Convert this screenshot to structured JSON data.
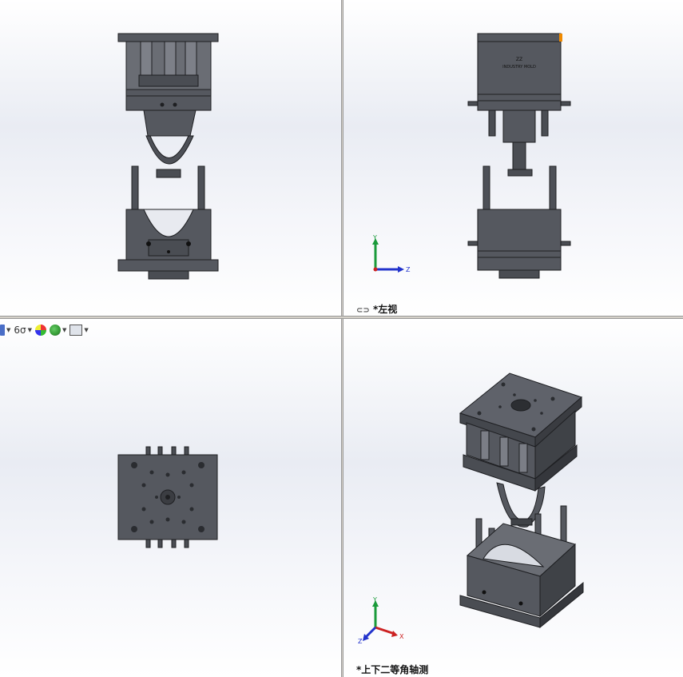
{
  "views": {
    "left_view_label": "左视",
    "dimetric_view_label": "上下二等角轴测"
  },
  "triad": {
    "y": "Y",
    "z": "Z",
    "x": "X"
  },
  "molds": {
    "top_brand_text": "INDUSTRY MOLD",
    "top_logo_text": "ZZ"
  },
  "colors": {
    "mold_fill": "#55585f",
    "mold_dark": "#2b2d31",
    "mold_light": "#7b7e86",
    "axis_y": "#1a9a3a",
    "axis_z": "#2233cc",
    "axis_x": "#cc2222"
  },
  "toolbar": {
    "icons": [
      "view-orientation-icon",
      "hide-show-icon",
      "appearance-icon",
      "scene-icon",
      "display-settings-icon"
    ]
  }
}
